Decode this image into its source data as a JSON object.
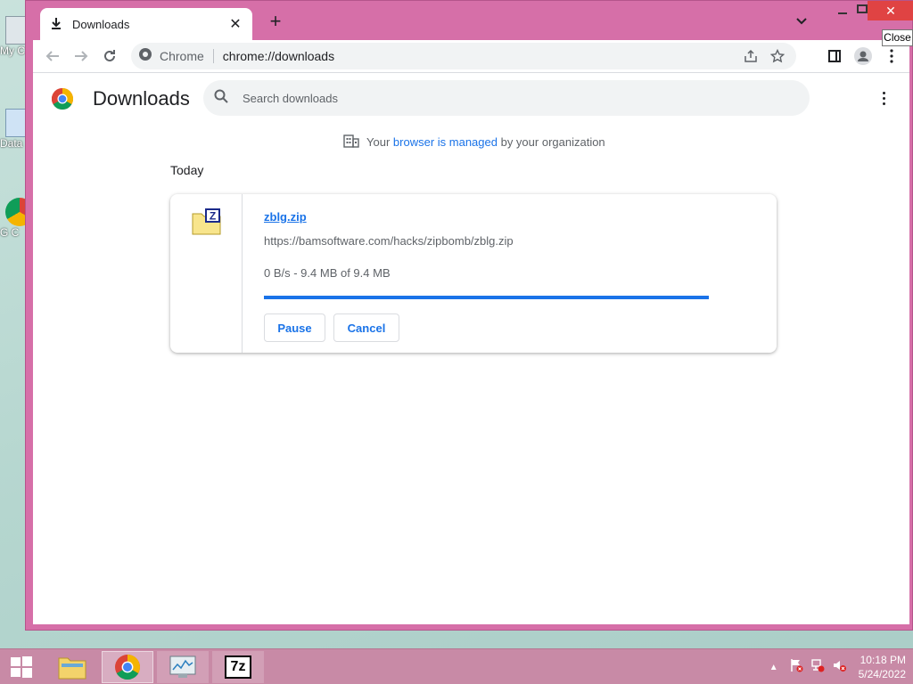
{
  "window": {
    "tab_title": "Downloads",
    "new_tab_symbol": "+",
    "close_tooltip": "Close"
  },
  "toolbar": {
    "site_label": "Chrome",
    "url": "chrome://downloads"
  },
  "page": {
    "title": "Downloads",
    "search_placeholder": "Search downloads",
    "managed_prefix": "Your",
    "managed_link": "browser is managed",
    "managed_suffix": "by your organization",
    "section_label": "Today"
  },
  "download": {
    "file_name": "zblg.zip",
    "source_url": "https://bamsoftware.com/hacks/zipbomb/zblg.zip",
    "status": "0 B/s - 9.4 MB of 9.4 MB",
    "progress": 1.0,
    "pause_label": "Pause",
    "cancel_label": "Cancel"
  },
  "taskbar": {
    "time": "10:18 PM",
    "date": "5/24/2022",
    "sevenzip_label": "7z"
  },
  "desktop": {
    "icon1_label": "My C",
    "icon2_label": "Data",
    "icon3_label": "G C"
  },
  "colors": {
    "window_frame": "#d66fa8",
    "accent": "#1a73e8",
    "taskbar": "#c88aa6"
  }
}
